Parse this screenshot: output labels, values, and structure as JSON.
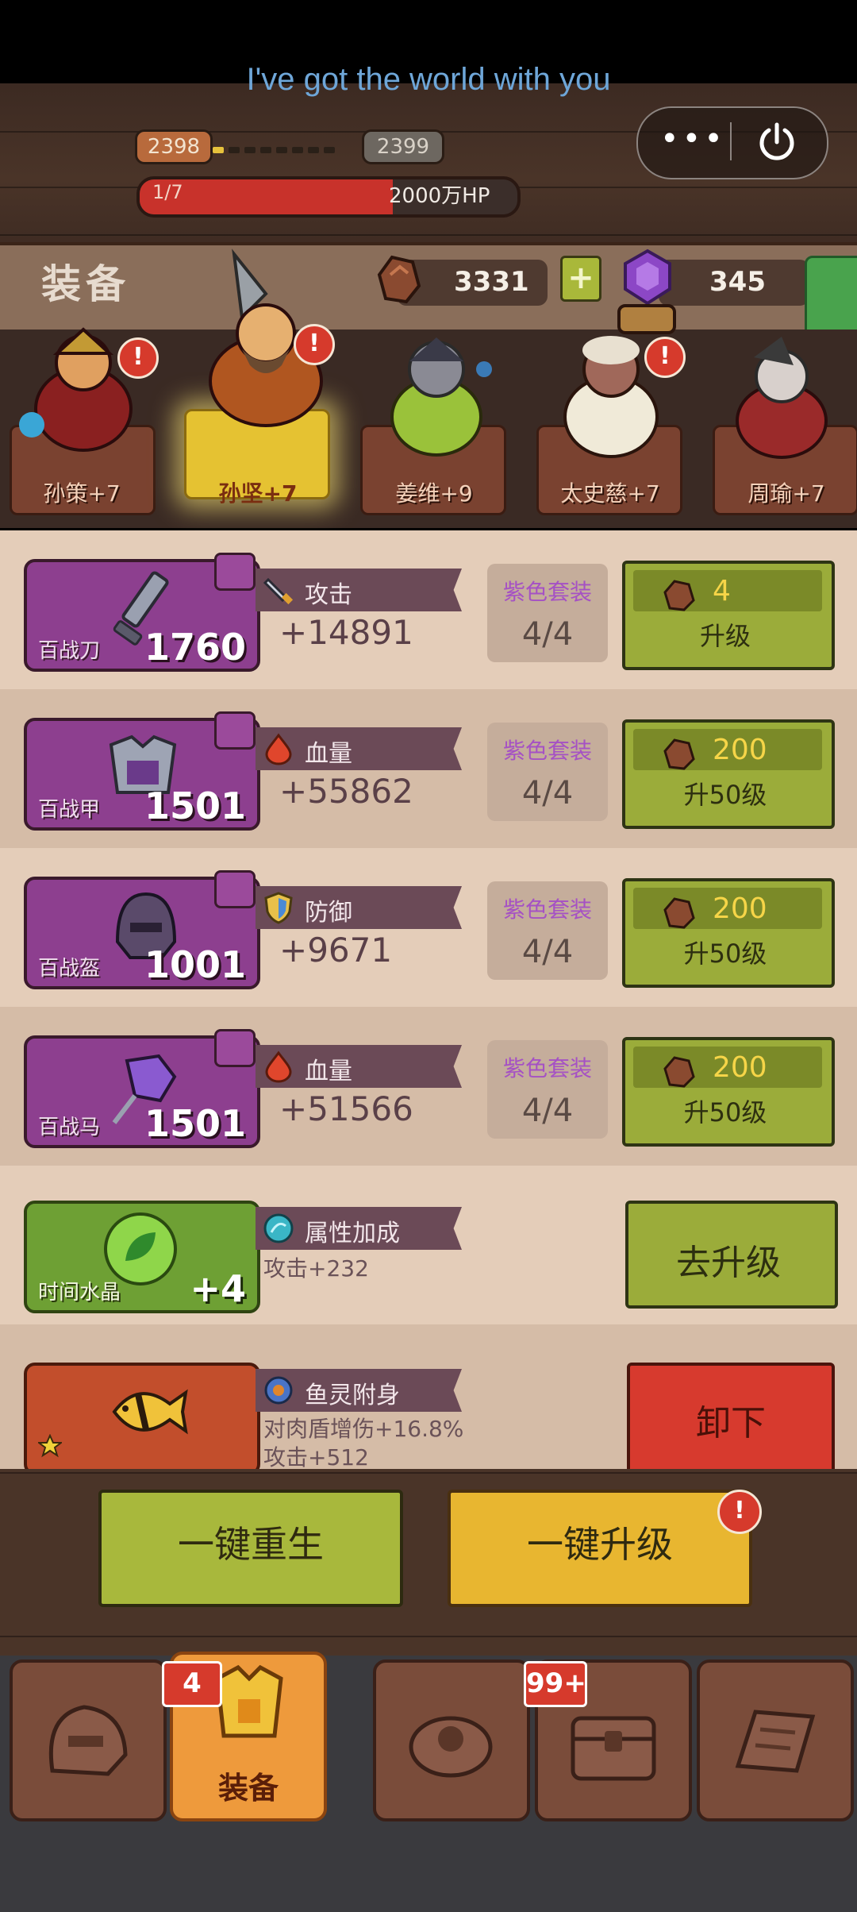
{
  "status": {
    "song_lyric": "I've got the world with you"
  },
  "level": {
    "current": "2398",
    "next": "2399",
    "hp_fraction": "1/7",
    "hp_value": "2000万HP",
    "hp_fill": 0.67
  },
  "header": {
    "title": "装备",
    "resource_stone": "3331",
    "resource_crystal": "345"
  },
  "heroes": [
    {
      "name": "孙策+7",
      "alert": "!",
      "selected": false
    },
    {
      "name": "孙坚+7",
      "alert": "!",
      "selected": true
    },
    {
      "name": "姜维+9",
      "alert": "",
      "selected": false
    },
    {
      "name": "太史慈+7",
      "alert": "!",
      "selected": false
    },
    {
      "name": "周瑜+7",
      "alert": "",
      "selected": false
    }
  ],
  "equipment": [
    {
      "name": "百战刀",
      "level": "1760",
      "stat_label": "攻击",
      "stat_value": "+14891",
      "set_title": "紫色套装",
      "set_value": "4/4",
      "cost": "4",
      "button": "升级"
    },
    {
      "name": "百战甲",
      "level": "1501",
      "stat_label": "血量",
      "stat_value": "+55862",
      "set_title": "紫色套装",
      "set_value": "4/4",
      "cost": "200",
      "button": "升50级"
    },
    {
      "name": "百战盔",
      "level": "1001",
      "stat_label": "防御",
      "stat_value": "+9671",
      "set_title": "紫色套装",
      "set_value": "4/4",
      "cost": "200",
      "button": "升50级"
    },
    {
      "name": "百战马",
      "level": "1501",
      "stat_label": "血量",
      "stat_value": "+51566",
      "set_title": "紫色套装",
      "set_value": "4/4",
      "cost": "200",
      "button": "升50级"
    }
  ],
  "crystal": {
    "name": "时间水晶",
    "level": "+4",
    "stat_label": "属性加成",
    "detail": "攻击+232",
    "button": "去升级"
  },
  "fish": {
    "stat_label": "鱼灵附身",
    "detail1": "对肉盾增伤+16.8%",
    "detail2": "攻击+512",
    "button": "卸下"
  },
  "actions": {
    "rebirth": "一键重生",
    "upgrade_all": "一键升级",
    "upgrade_alert": "!"
  },
  "nav": {
    "equip_label": "装备",
    "equip_badge": "4",
    "chest_badge": "99+"
  },
  "colors": {
    "purple_card": "#8d3f8f",
    "green_button": "#9bac3a",
    "red_button": "#d73a2e",
    "yellow_button": "#e8b630",
    "hp_red": "#c8322b"
  }
}
